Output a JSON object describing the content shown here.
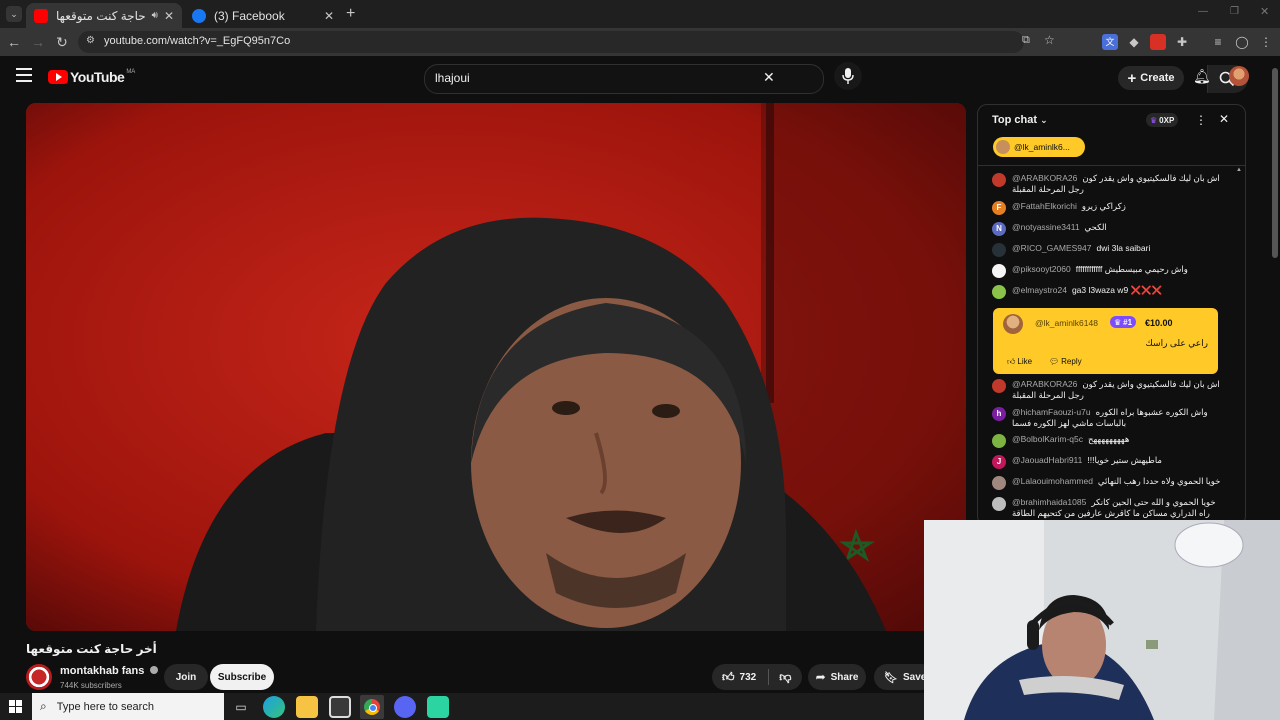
{
  "browser": {
    "tabs": [
      {
        "title": "أخر حاجة كنت متوقعها - YouTube",
        "close": "✕",
        "active": true
      },
      {
        "title": "(3) Facebook",
        "close": "✕",
        "active": false
      }
    ],
    "new_tab": "+",
    "url": "youtube.com/watch?v=_EgFQ95n7Co"
  },
  "youtube": {
    "logo_text": "YouTube",
    "region": "MA",
    "search_value": "lhajoui",
    "create_label": "Create"
  },
  "video": {
    "title": "أخر حاجة كنت متوقعها",
    "channel": "montakhab fans",
    "subscribers": "744K subscribers",
    "join_label": "Join",
    "subscribe_label": "Subscribe",
    "likes": "732",
    "share_label": "Share",
    "save_label": "Save"
  },
  "chat": {
    "mode_label": "Top chat",
    "points": "0XP",
    "pinned_user": "@lk_aminlk6...",
    "messages_top": [
      {
        "author": "@ARABKORA26",
        "text": "اش بان ليك فالسكيتيوي واش يقدر كون رجل المرحلة المقبلة",
        "avatar_color": "#c0392b",
        "initial": ""
      },
      {
        "author": "@FattahElkorichi",
        "text": "زكراكي زيرو",
        "avatar_color": "#e67e22",
        "initial": "F"
      },
      {
        "author": "@notyassine3411",
        "text": "الكحي",
        "avatar_color": "#5c6bc0",
        "initial": "N"
      },
      {
        "author": "@RICO_GAMES947",
        "text": "dwi 3la saibari",
        "avatar_color": "#263238",
        "initial": ""
      },
      {
        "author": "@piksooyt2060",
        "text": "ffffffffffff واش رحيمي مبيسطيش",
        "avatar_color": "#f5f5f5",
        "initial": ""
      },
      {
        "author": "@elmaystro24",
        "text": "ga3 l3waza w9 ❌❌❌",
        "avatar_color": "#8bc34a",
        "initial": ""
      }
    ],
    "superchat": {
      "author": "@lk_aminlk6148",
      "badge": "#1",
      "amount": "€10.00",
      "text": "راعي على راسك",
      "like_label": "Like",
      "reply_label": "Reply"
    },
    "messages_bottom": [
      {
        "author": "@ARABKORA26",
        "text": "اش بان ليك فالسكيتيوي واش يقدر كون رجل المرحلة المقبلة",
        "avatar_color": "#c0392b",
        "initial": ""
      },
      {
        "author": "@hichamFaouzi-u7u",
        "text": "واش الكوره عشبوها براه الكوره بالباسات ماشي لهز الكوره فسما",
        "avatar_color": "#7b1fa2",
        "initial": "h"
      },
      {
        "author": "@BolbolKarim-q5c",
        "text": "هههههههههح",
        "avatar_color": "#7cb342",
        "initial": ""
      },
      {
        "author": "@JaouadHabri911",
        "text": "ماطيهش ستير خويا!!!",
        "avatar_color": "#c2185b",
        "initial": "J"
      },
      {
        "author": "@Lalaouimohammed",
        "text": "خويا الحموي ولاه حددا رهب النهائي",
        "avatar_color": "#a1887f",
        "initial": ""
      },
      {
        "author": "@brahimhaida1085",
        "text": "خويا الحموي و الله حتى الحين كانكر راه الدراري مساكن ما كاقرش عارفين من كتحيهم الطاقة السلبية",
        "avatar_color": "#bdbdbd",
        "initial": ""
      }
    ]
  },
  "taskbar": {
    "search_placeholder": "Type here to search"
  },
  "colors": {
    "youtube_red": "#ff0000",
    "superchat_yellow": "#ffca28",
    "subscribe_bg": "#f1f1f1",
    "video_red": "#b81b12"
  }
}
